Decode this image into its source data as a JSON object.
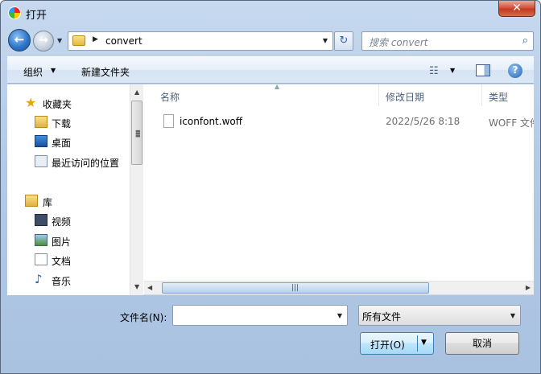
{
  "window": {
    "title": "打开"
  },
  "nav": {
    "back_glyph": "←",
    "forward_glyph": "→",
    "address": {
      "crumb_arrow": "▶",
      "path": "convert"
    },
    "refresh_glyph": "↻",
    "search_placeholder": "搜索 convert",
    "search_glyph": "⌕"
  },
  "toolbar": {
    "organize_label": "组织",
    "new_folder_label": "新建文件夹",
    "view_glyph": "☷",
    "help_glyph": "?"
  },
  "sidebar": {
    "favorites_label": "收藏夹",
    "favorites": [
      {
        "label": "下载",
        "icon": "downloads-icon"
      },
      {
        "label": "桌面",
        "icon": "desktop-icon"
      },
      {
        "label": "最近访问的位置",
        "icon": "recent-places-icon"
      }
    ],
    "libraries_label": "库",
    "libraries": [
      {
        "label": "视频",
        "icon": "video-icon"
      },
      {
        "label": "图片",
        "icon": "pictures-icon"
      },
      {
        "label": "文档",
        "icon": "documents-icon"
      },
      {
        "label": "音乐",
        "icon": "music-icon"
      }
    ]
  },
  "columns": [
    {
      "label": "名称"
    },
    {
      "label": "修改日期"
    },
    {
      "label": "类型"
    }
  ],
  "files": [
    {
      "name": "iconfont.woff",
      "modified": "2022/5/26 8:18",
      "type": "WOFF 文件"
    }
  ],
  "bottom": {
    "filename_label": "文件名(N):",
    "filename_value": "",
    "filter_value": "所有文件",
    "open_label": "打开(O)",
    "cancel_label": "取消"
  },
  "colors": {
    "titlebar": "#c6d9ef",
    "close_button": "#c43a1f",
    "open_button": "#bee6fd"
  }
}
